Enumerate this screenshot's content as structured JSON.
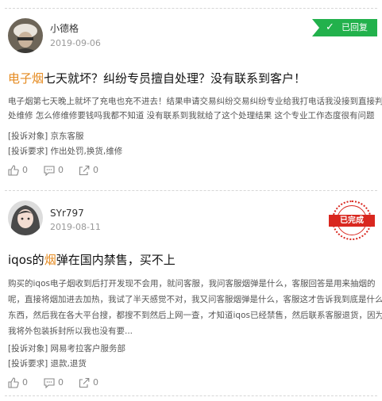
{
  "complaints": [
    {
      "user": "小德格",
      "date": "2019-09-06",
      "status": "已回复",
      "title_highlight": "电子烟",
      "title_rest": "七天就坏？纠纷专员擅自处理？没有联系到客户！",
      "body_lines": [
        "电子烟第七天晚上就坏了充电也充不进去！结果申请交易纠纷交易纠纷专业给我打电话我没接到直接判",
        "处维修 怎么修维修要钱吗我都不知道 没有联系到我就给了这个处理结果 这个专业工作态度很有问题"
      ],
      "target_label": "[投诉对象]",
      "target_value": "京东客服",
      "request_label": "[投诉要求]",
      "request_value": "作出处罚,换货,维修",
      "likes": "0",
      "comments": "0",
      "shares": "0"
    },
    {
      "user": "SYr797",
      "date": "2019-08-11",
      "status": "已完成",
      "title_prefix": "iqos的",
      "title_highlight": "烟",
      "title_rest": "弹在国内禁售，买不上",
      "body_lines": [
        "购买的iqos电子烟收到后打开发现不会用，就问客服，我问客服烟弹是什么，客服回答是用来抽烟的",
        "呢，直接将烟加进去加热，我试了半天感觉不对，我又问客服烟弹是什么，客服这才告诉我到底是什么",
        "东西，然后我在各大平台搜，都搜不到然后上网一查，才知道iqos已经禁售，然后联系客服退货，因为",
        "我将外包装拆封所以我也没有要..."
      ],
      "target_label": "[投诉对象]",
      "target_value": "网易考拉客户服务部",
      "request_label": "[投诉要求]",
      "request_value": "退款,退货",
      "likes": "0",
      "comments": "0",
      "shares": "0"
    }
  ],
  "colors": {
    "replied_green": "#22b14c",
    "completed_red": "#d9271f",
    "highlight_orange": "#e58a1f"
  },
  "icons": [
    "thumbs-up-icon",
    "comment-icon",
    "share-icon",
    "checkmark-icon"
  ]
}
